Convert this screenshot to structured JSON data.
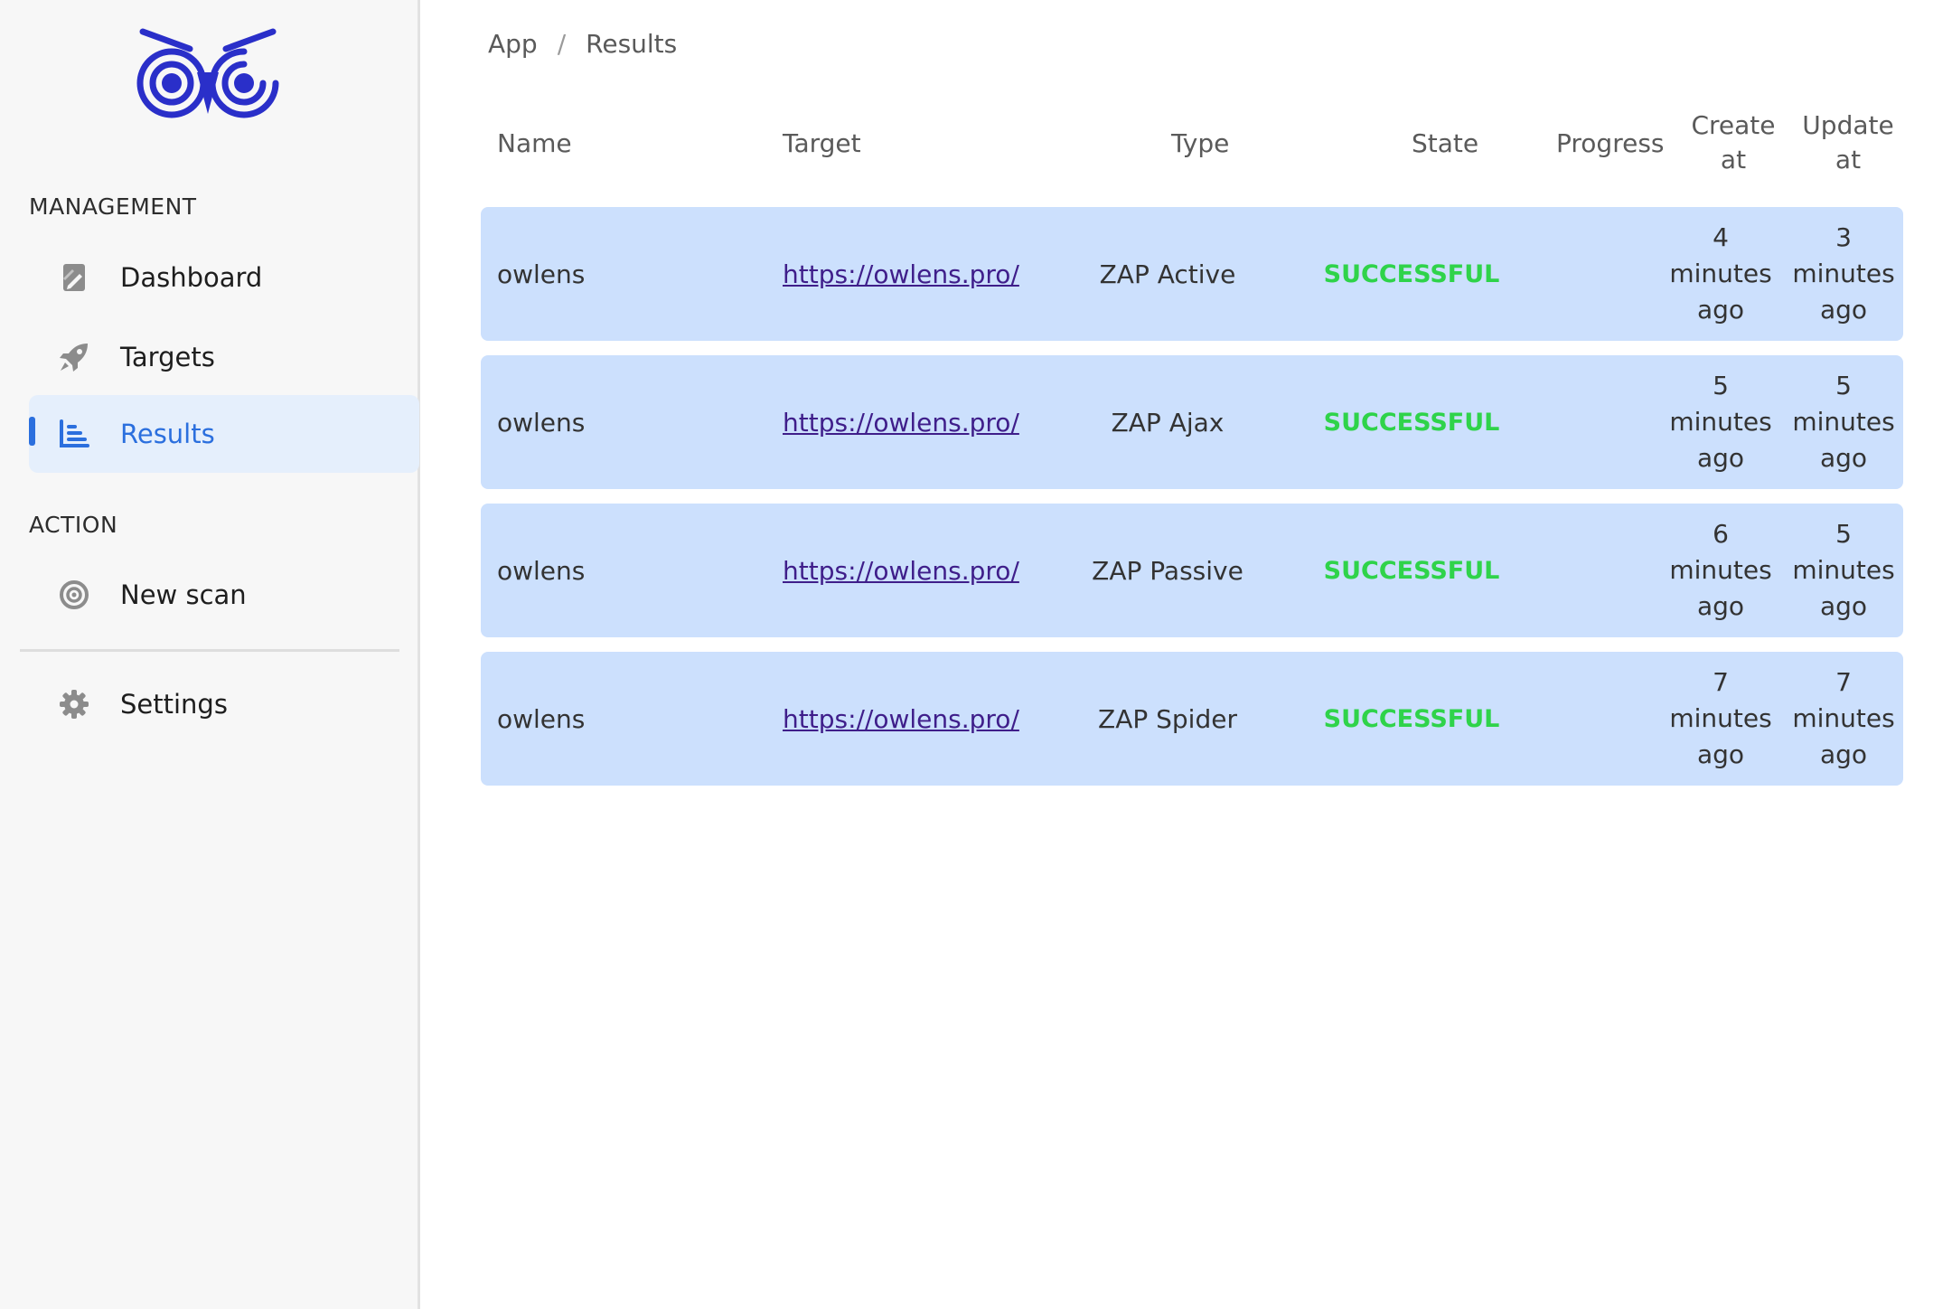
{
  "sidebar": {
    "sections": {
      "management": "MANAGEMENT",
      "action": "ACTION"
    },
    "items": {
      "dashboard": "Dashboard",
      "targets": "Targets",
      "results": "Results",
      "new_scan": "New scan",
      "settings": "Settings"
    },
    "active_item": "Results",
    "accent_color": "#2b6fde",
    "logo_color": "#2a2fc9"
  },
  "breadcrumb": {
    "root": "App",
    "separator": "/",
    "current": "Results"
  },
  "table": {
    "headers": {
      "name": "Name",
      "target": "Target",
      "type": "Type",
      "state": "State",
      "progress": "Progress",
      "create_at": "Create at",
      "update_at": "Update at"
    },
    "rows": [
      {
        "name": "owlens",
        "target": "https://owlens.pro/",
        "type": "ZAP Active",
        "state": "SUCCESSFUL",
        "progress": "",
        "create_at": "4 minutes ago",
        "update_at": "3 minutes ago"
      },
      {
        "name": "owlens",
        "target": "https://owlens.pro/",
        "type": "ZAP Ajax",
        "state": "SUCCESSFUL",
        "progress": "",
        "create_at": "5 minutes ago",
        "update_at": "5 minutes ago"
      },
      {
        "name": "owlens",
        "target": "https://owlens.pro/",
        "type": "ZAP Passive",
        "state": "SUCCESSFUL",
        "progress": "",
        "create_at": "6 minutes ago",
        "update_at": "5 minutes ago"
      },
      {
        "name": "owlens",
        "target": "https://owlens.pro/",
        "type": "ZAP Spider",
        "state": "SUCCESSFUL",
        "progress": "",
        "create_at": "7 minutes ago",
        "update_at": "7 minutes ago"
      }
    ],
    "row_color": "#cce0fd",
    "success_color": "#2fd34a"
  }
}
